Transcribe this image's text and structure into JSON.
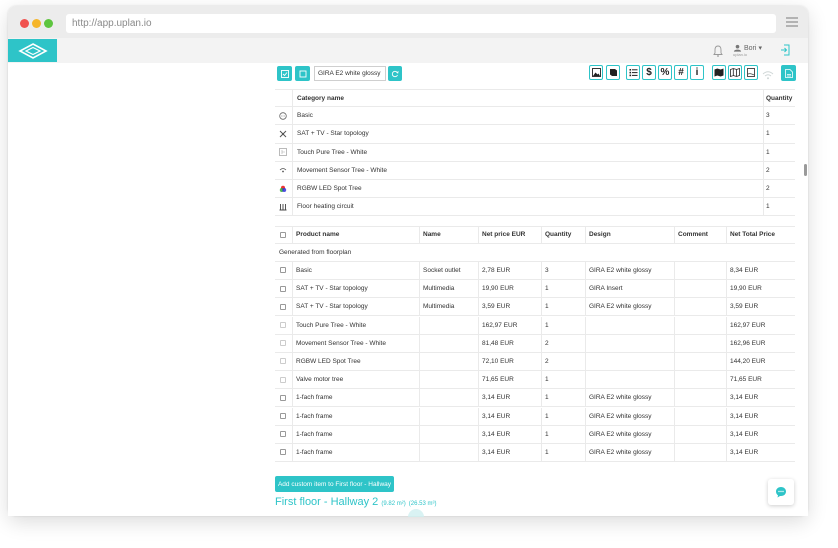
{
  "browser": {
    "url": "http://app.uplan.io"
  },
  "header": {
    "user_name": "Bori",
    "user_sub": "uplan.io",
    "dropdown_caret": "▾"
  },
  "toolbar": {
    "design_select_value": "GIRA E2 white glossy",
    "right_icons": [
      "image-icon",
      "book-icon",
      "list-icon",
      "dollar-icon",
      "percent-icon",
      "hash-icon",
      "info-icon",
      "map-icon",
      "map-outline-icon",
      "page-icon",
      "wifi-icon",
      "pdf-icon"
    ],
    "dollar": "$",
    "percent": "%",
    "hash": "#",
    "info": "i"
  },
  "category_table": {
    "headers": {
      "name": "Category name",
      "quantity": "Quantity"
    },
    "rows": [
      {
        "icon": "socket-icon",
        "name": "Basic",
        "quantity": "3"
      },
      {
        "icon": "satellite-icon",
        "name": "SAT + TV - Star topology",
        "quantity": "1"
      },
      {
        "icon": "touch-icon",
        "name": "Touch Pure Tree - White",
        "quantity": "1"
      },
      {
        "icon": "sensor-icon",
        "name": "Movement Sensor Tree - White",
        "quantity": "2"
      },
      {
        "icon": "rgb-icon",
        "name": "RGBW LED Spot Tree",
        "quantity": "2"
      },
      {
        "icon": "heating-icon",
        "name": "Floor heating circuit",
        "quantity": "1"
      }
    ]
  },
  "product_table": {
    "headers": {
      "product": "Product name",
      "name": "Name",
      "price": "Net price EUR",
      "quantity": "Quantity",
      "design": "Design",
      "comment": "Comment",
      "total": "Net Total Price"
    },
    "group_label": "Generated from floorplan",
    "rows": [
      {
        "product": "Basic",
        "name": "Socket outlet",
        "price": "2,78 EUR",
        "quantity": "3",
        "design": "GIRA E2 white glossy",
        "comment": "",
        "total": "8,34 EUR",
        "checkbox": true
      },
      {
        "product": "SAT + TV - Star topology",
        "name": "Multimedia",
        "price": "19,90 EUR",
        "quantity": "1",
        "design": "GIRA Insert",
        "comment": "",
        "total": "19,90 EUR",
        "checkbox": true
      },
      {
        "product": "SAT + TV - Star topology",
        "name": "Multimedia",
        "price": "3,59 EUR",
        "quantity": "1",
        "design": "GIRA E2 white glossy",
        "comment": "",
        "total": "3,59 EUR",
        "checkbox": true
      },
      {
        "product": "Touch Pure Tree - White",
        "name": "",
        "price": "162,97 EUR",
        "quantity": "1",
        "design": "",
        "comment": "",
        "total": "162,97 EUR",
        "checkbox": false
      },
      {
        "product": "Movement Sensor Tree - White",
        "name": "",
        "price": "81,48 EUR",
        "quantity": "2",
        "design": "",
        "comment": "",
        "total": "162,96 EUR",
        "checkbox": false
      },
      {
        "product": "RGBW LED Spot Tree",
        "name": "",
        "price": "72,10 EUR",
        "quantity": "2",
        "design": "",
        "comment": "",
        "total": "144,20 EUR",
        "checkbox": false
      },
      {
        "product": "Valve motor tree",
        "name": "",
        "price": "71,65 EUR",
        "quantity": "1",
        "design": "",
        "comment": "",
        "total": "71,65 EUR",
        "checkbox": false
      },
      {
        "product": "1-fach frame",
        "name": "",
        "price": "3,14 EUR",
        "quantity": "1",
        "design": "GIRA E2 white glossy",
        "comment": "",
        "total": "3,14 EUR",
        "checkbox": true
      },
      {
        "product": "1-fach frame",
        "name": "",
        "price": "3,14 EUR",
        "quantity": "1",
        "design": "GIRA E2 white glossy",
        "comment": "",
        "total": "3,14 EUR",
        "checkbox": true
      },
      {
        "product": "1-fach frame",
        "name": "",
        "price": "3,14 EUR",
        "quantity": "1",
        "design": "GIRA E2 white glossy",
        "comment": "",
        "total": "3,14 EUR",
        "checkbox": true
      },
      {
        "product": "1-fach frame",
        "name": "",
        "price": "3,14 EUR",
        "quantity": "1",
        "design": "GIRA E2 white glossy",
        "comment": "",
        "total": "3,14 EUR",
        "checkbox": true
      }
    ]
  },
  "add_custom_button": "Add custom item to First floor - Hallway",
  "next_room": {
    "title": "First floor - Hallway 2",
    "area": "(9.82 m²)",
    "volume": "(26.53 m³)"
  },
  "colors": {
    "accent": "#2ec4c8",
    "chrome": "#ececec"
  }
}
